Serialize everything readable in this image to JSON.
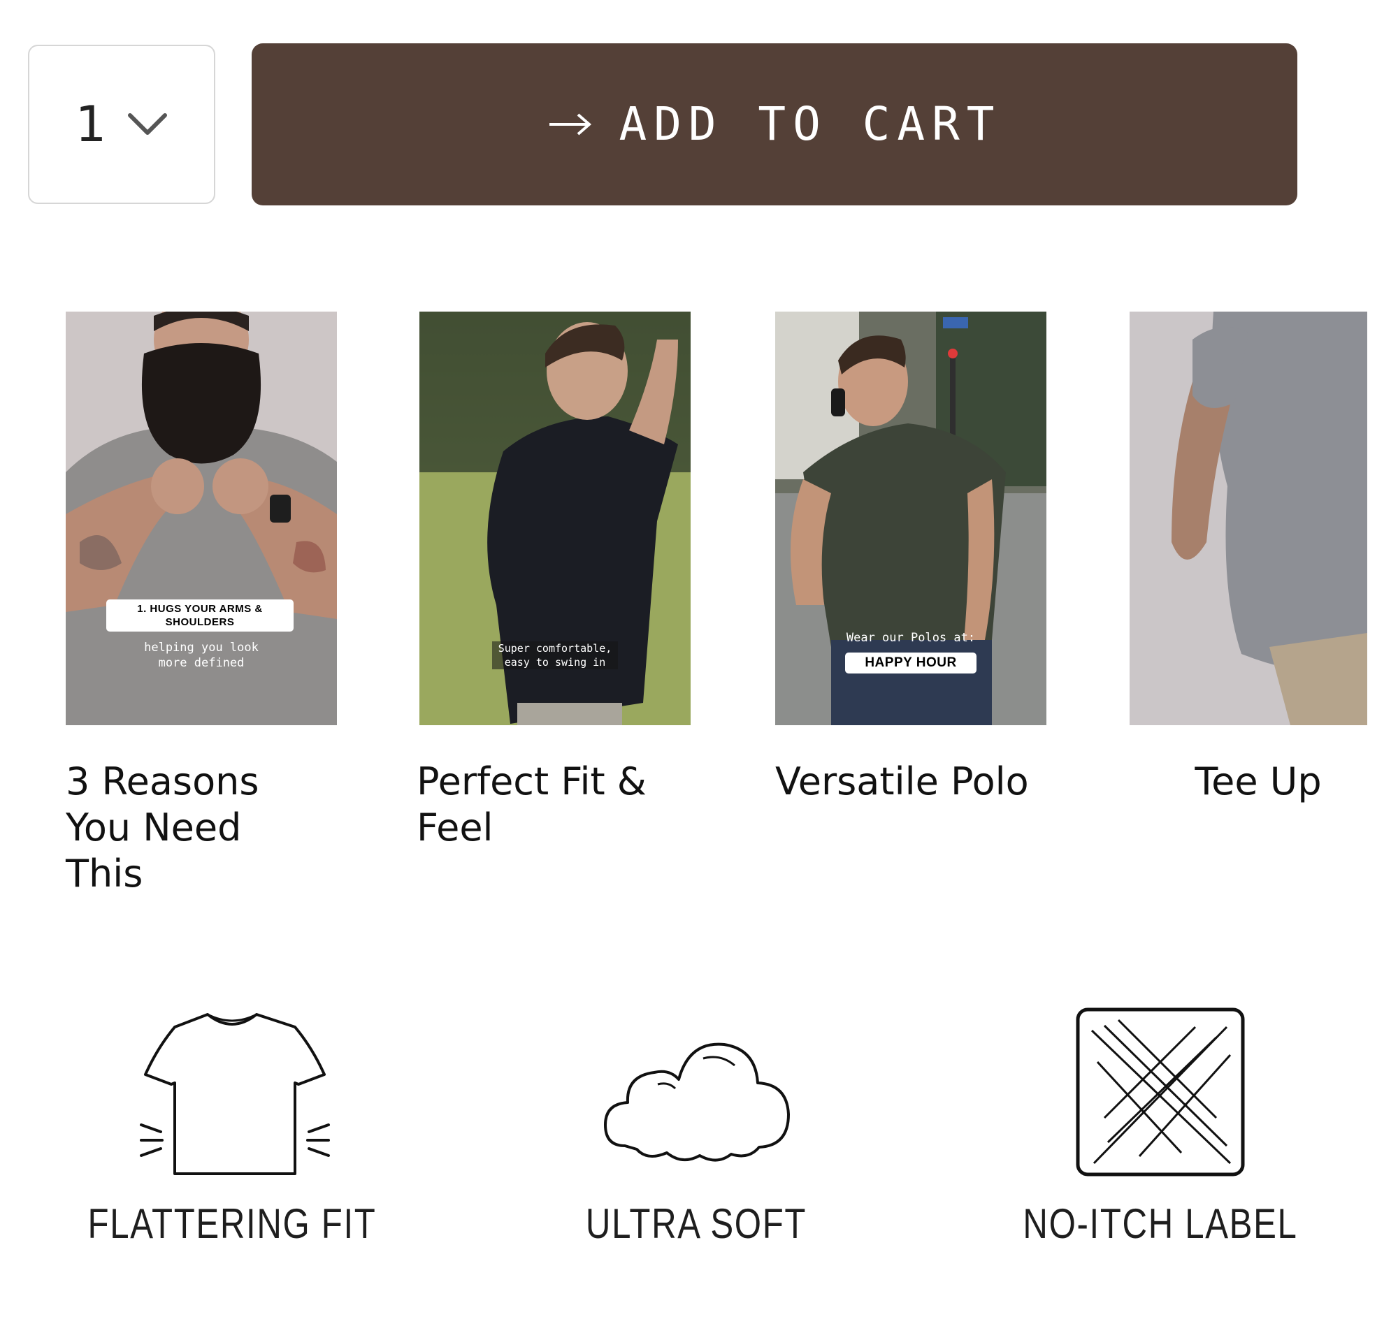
{
  "purchase": {
    "quantity": "1",
    "add_to_cart_label": "ADD TO CART",
    "button_color": "#544037"
  },
  "videos": [
    {
      "title": "3 Reasons You Need This",
      "overlay_tag": "1. HUGS YOUR ARMS & SHOULDERS",
      "overlay_text": "helping you look more defined"
    },
    {
      "title": "Perfect Fit & Feel",
      "overlay_text": "Super comfortable, easy to swing in"
    },
    {
      "title": "Versatile Polo",
      "overlay_text": "Wear our Polos at:",
      "overlay_tag": "HAPPY HOUR"
    },
    {
      "title": "Tee Up"
    }
  ],
  "features": [
    {
      "label": "FLATTERING FIT",
      "icon": "tshirt-icon"
    },
    {
      "label": "ULTRA SOFT",
      "icon": "cloud-icon"
    },
    {
      "label": "NO-ITCH LABEL",
      "icon": "no-itch-label-icon"
    }
  ]
}
